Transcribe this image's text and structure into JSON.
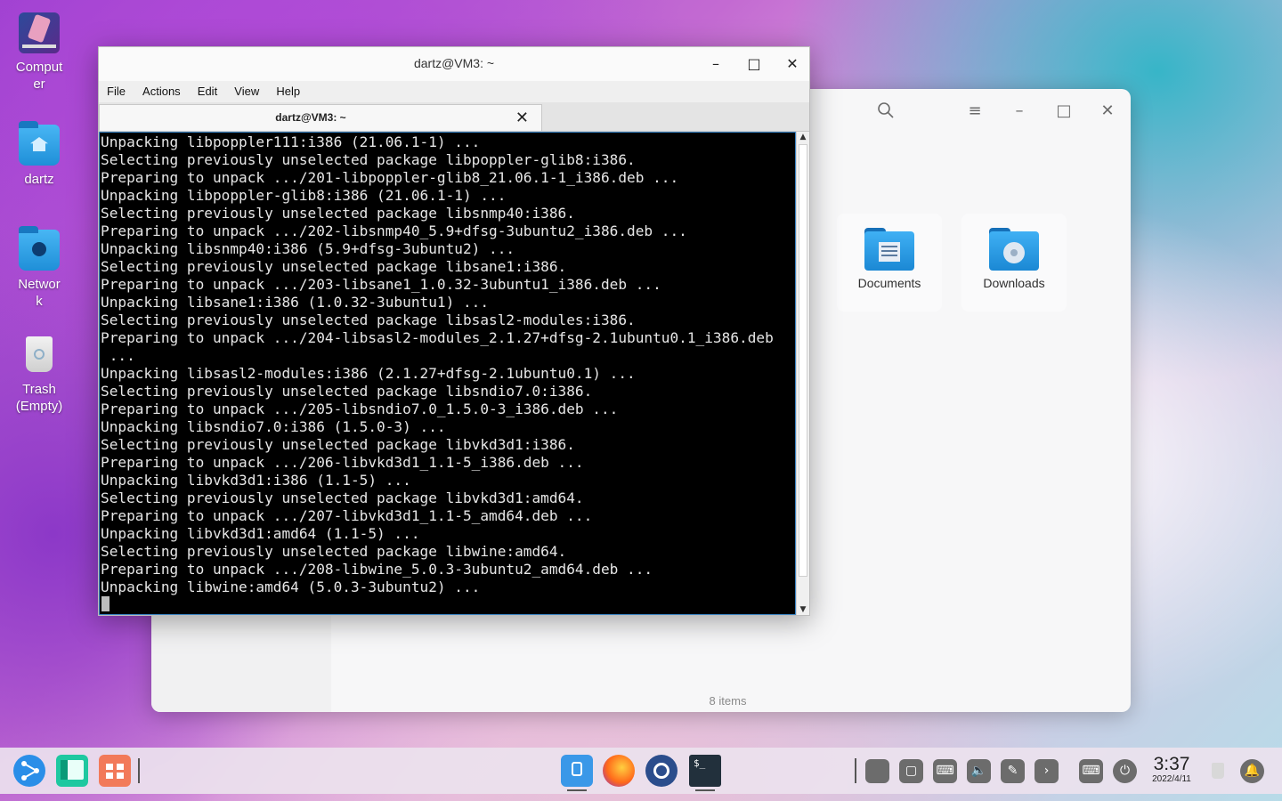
{
  "desktop": {
    "icons": [
      {
        "label": "Comput\ner",
        "icon": "computer-icon"
      },
      {
        "label": "dartz",
        "icon": "home-folder-icon"
      },
      {
        "label": "Networ\nk",
        "icon": "network-folder-icon"
      },
      {
        "label": "Trash\n(Empty)",
        "icon": "trash-icon"
      }
    ]
  },
  "file_manager": {
    "folders": [
      {
        "label": "Documents",
        "icon": "documents-folder-icon"
      },
      {
        "label": "Downloads",
        "icon": "downloads-folder-icon"
      }
    ],
    "status": "8 items"
  },
  "terminal": {
    "title": "dartz@VM3: ~",
    "menu": [
      "File",
      "Actions",
      "Edit",
      "View",
      "Help"
    ],
    "tab_label": "dartz@VM3: ~",
    "lines": [
      "Unpacking libpoppler111:i386 (21.06.1-1) ...",
      "Selecting previously unselected package libpoppler-glib8:i386.",
      "Preparing to unpack .../201-libpoppler-glib8_21.06.1-1_i386.deb ...",
      "Unpacking libpoppler-glib8:i386 (21.06.1-1) ...",
      "Selecting previously unselected package libsnmp40:i386.",
      "Preparing to unpack .../202-libsnmp40_5.9+dfsg-3ubuntu2_i386.deb ...",
      "Unpacking libsnmp40:i386 (5.9+dfsg-3ubuntu2) ...",
      "Selecting previously unselected package libsane1:i386.",
      "Preparing to unpack .../203-libsane1_1.0.32-3ubuntu1_i386.deb ...",
      "Unpacking libsane1:i386 (1.0.32-3ubuntu1) ...",
      "Selecting previously unselected package libsasl2-modules:i386.",
      "Preparing to unpack .../204-libsasl2-modules_2.1.27+dfsg-2.1ubuntu0.1_i386.deb",
      " ...",
      "Unpacking libsasl2-modules:i386 (2.1.27+dfsg-2.1ubuntu0.1) ...",
      "Selecting previously unselected package libsndio7.0:i386.",
      "Preparing to unpack .../205-libsndio7.0_1.5.0-3_i386.deb ...",
      "Unpacking libsndio7.0:i386 (1.5.0-3) ...",
      "Selecting previously unselected package libvkd3d1:i386.",
      "Preparing to unpack .../206-libvkd3d1_1.1-5_i386.deb ...",
      "Unpacking libvkd3d1:i386 (1.1-5) ...",
      "Selecting previously unselected package libvkd3d1:amd64.",
      "Preparing to unpack .../207-libvkd3d1_1.1-5_amd64.deb ...",
      "Unpacking libvkd3d1:amd64 (1.1-5) ...",
      "Selecting previously unselected package libwine:amd64.",
      "Preparing to unpack .../208-libwine_5.0.3-3ubuntu2_amd64.deb ...",
      "Unpacking libwine:amd64 (5.0.3-3ubuntu2) ..."
    ]
  },
  "taskbar": {
    "clock_time": "3:37",
    "clock_date": "2022/4/11",
    "colors": {
      "accent": "#1e88d8",
      "terminal_bg": "#000000"
    }
  }
}
